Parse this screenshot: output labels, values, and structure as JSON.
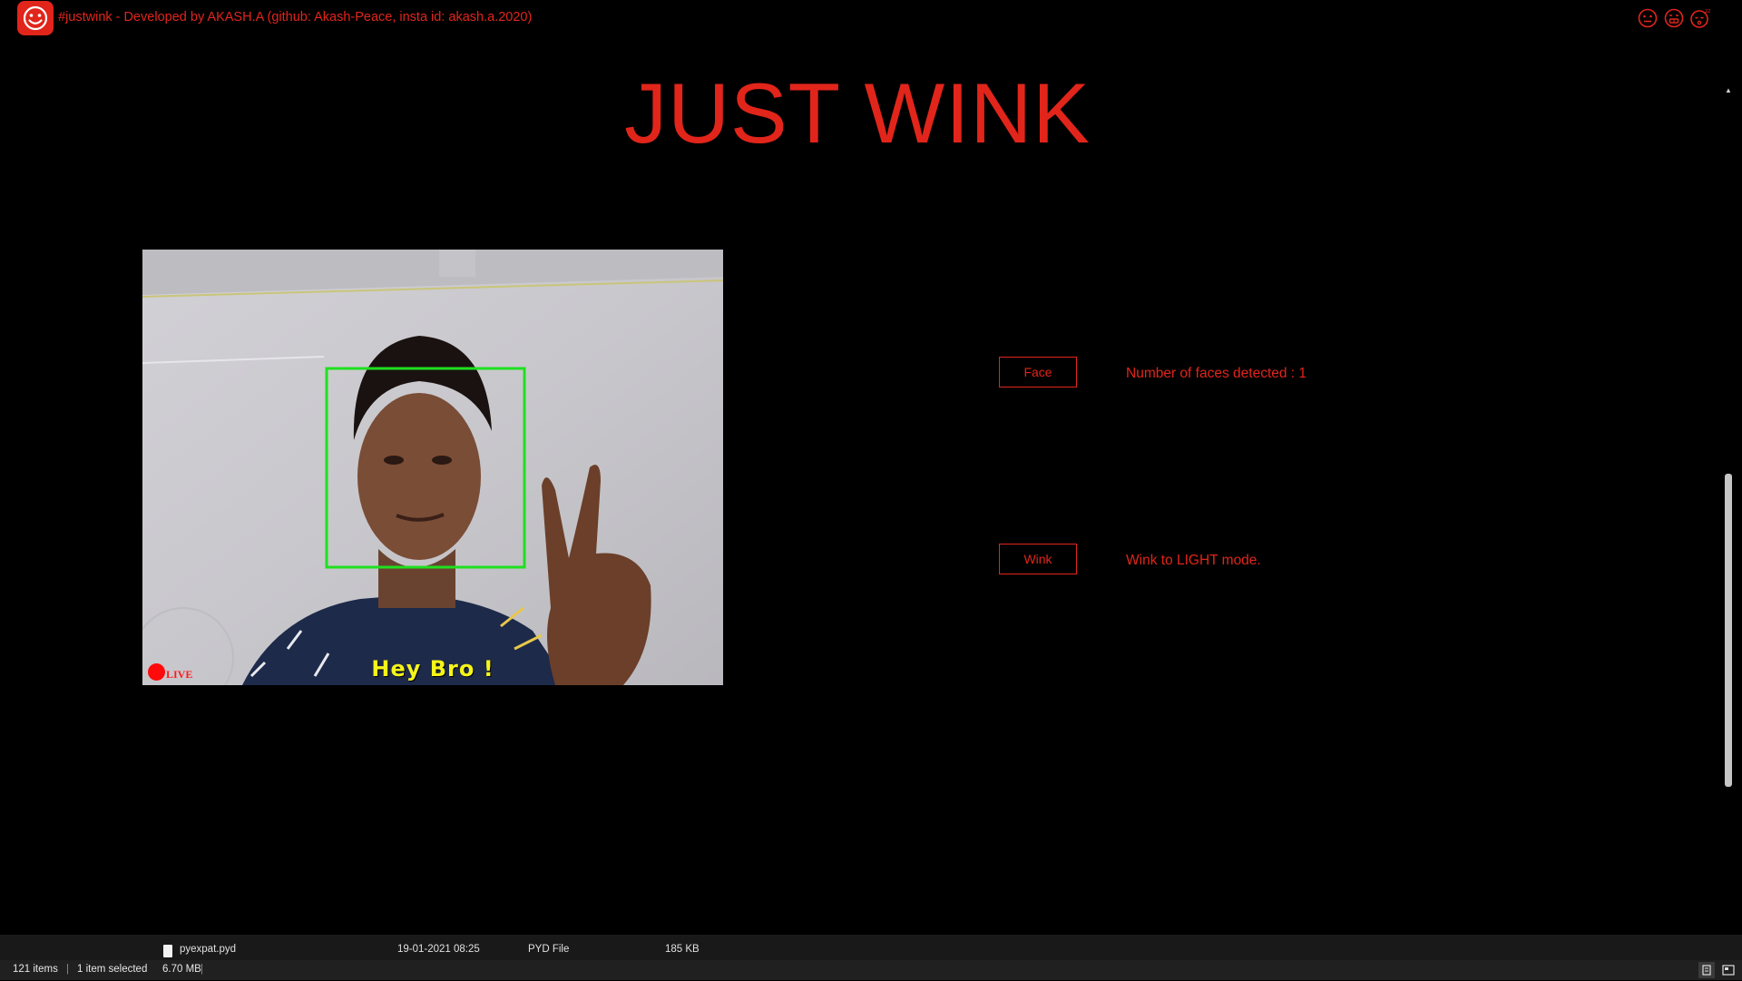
{
  "window": {
    "title": "#justwink - Developed by AKASH.A (github: Akash-Peace, insta id: akash.a.2020)",
    "app_icon": "smiley-logo-icon",
    "title_icons": [
      "face-icon",
      "grin-icon",
      "sleep-face-icon"
    ],
    "accent_color": "#e1251b"
  },
  "heading": "JUST WINK",
  "camera": {
    "caption": "Hey Bro !",
    "live_label": "LIVE",
    "face_box_color": "#1fe01f"
  },
  "controls": {
    "face_button": "Face",
    "face_status": "Number of faces detected : 1",
    "wink_button": "Wink",
    "wink_status": "Wink to LIGHT mode."
  },
  "explorer": {
    "files": [
      {
        "name": "pyexpat.pyd",
        "date": "19-01-2021 08:25",
        "type": "PYD File",
        "size": "185 KB"
      }
    ],
    "status": {
      "items": "121 items",
      "selected": "1 item selected",
      "selected_size": "6.70 MB"
    }
  }
}
